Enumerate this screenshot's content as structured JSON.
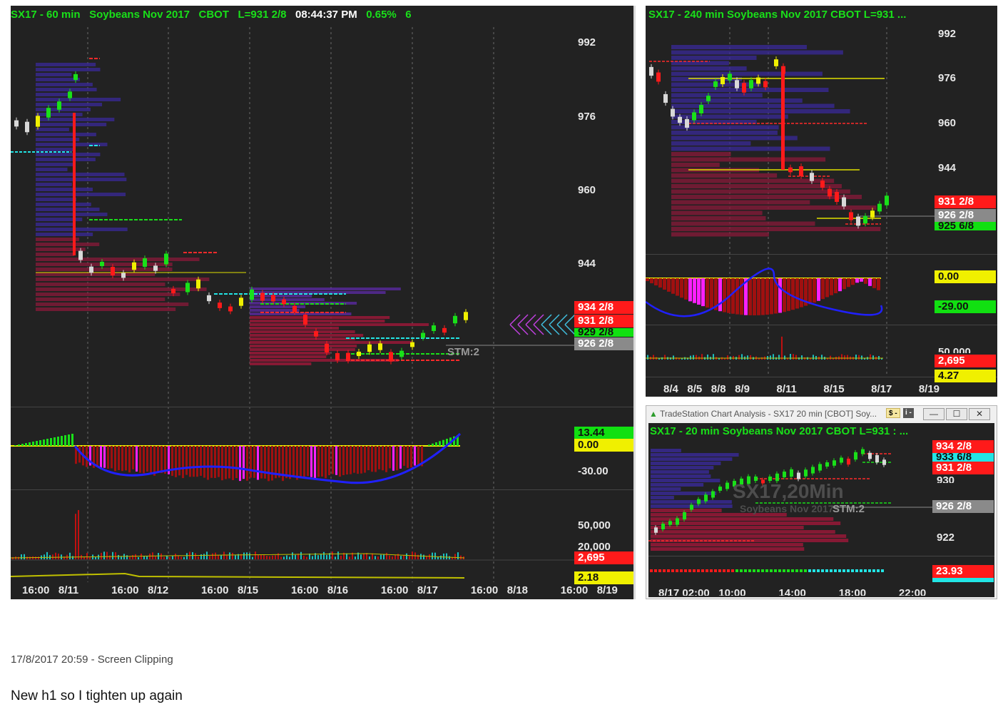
{
  "main_chart": {
    "title_symbol": "SX17 - 60 min",
    "title_name": "Soybeans Nov 2017",
    "title_exchange": "CBOT",
    "title_last": "L=931 2/8",
    "title_time": "08:44:37 PM",
    "title_change": "0.65%",
    "title_count": "6",
    "price_axis": [
      "992",
      "976",
      "960",
      "944"
    ],
    "price_boxes": [
      {
        "text": "934 2/8",
        "color": "red"
      },
      {
        "text": "931 2/8",
        "color": "red"
      },
      {
        "text": "929 2/8",
        "color": "green"
      },
      {
        "text": "926 2/8",
        "color": "gray"
      }
    ],
    "stm_label": "STM:2",
    "osc_boxes": [
      {
        "text": "13.44",
        "color": "green"
      },
      {
        "text": "0.00",
        "color": "yellow"
      }
    ],
    "osc_axis": "-30.00",
    "volume_axis": [
      "50,000",
      "20,000"
    ],
    "volume_boxes": [
      {
        "text": "2,695",
        "color": "red"
      },
      {
        "text": "2.18",
        "color": "yellow"
      }
    ],
    "time_axis": [
      "16:00",
      "8/11",
      "16:00",
      "8/12",
      "16:00",
      "8/15",
      "16:00",
      "8/16",
      "16:00",
      "8/17",
      "16:00",
      "8/18",
      "16:00",
      "8/19"
    ]
  },
  "chart_240": {
    "title": "SX17 - 240 min  Soybeans Nov 2017  CBOT  L=931  ...",
    "price_axis": [
      "992",
      "976",
      "960",
      "944"
    ],
    "price_boxes": [
      {
        "text": "931 2/8",
        "color": "red"
      },
      {
        "text": "926 2/8",
        "color": "gray"
      },
      {
        "text": "925 6/8",
        "color": "green"
      }
    ],
    "osc_boxes": [
      {
        "text": "0.00",
        "color": "yellow"
      },
      {
        "text": "-29.00",
        "color": "green"
      }
    ],
    "volume_boxes": [
      {
        "text": "50,000",
        "color": "none"
      },
      {
        "text": "2,695",
        "color": "red"
      },
      {
        "text": "4.27",
        "color": "yellow"
      }
    ],
    "time_axis": [
      "8/4",
      "8/5",
      "8/8",
      "8/9",
      "8/11",
      "8/15",
      "8/17",
      "8/19"
    ]
  },
  "window_20": {
    "window_title": "TradeStation Chart Analysis - SX17 20 min [CBOT] Soy...",
    "btn_dollar": "$ -",
    "btn_i": "i -",
    "btn_min": "—",
    "btn_max": "☐",
    "btn_close": "✕",
    "title": "SX17 - 20 min  Soybeans Nov 2017  CBOT  L=931 : ...",
    "watermark_big": "SX17,20Min",
    "watermark_small": "Soybeans Nov 2017",
    "stm_label": "STM:2",
    "price_axis": [
      "930",
      "922"
    ],
    "price_boxes": [
      {
        "text": "934 2/8",
        "color": "red"
      },
      {
        "text": "933 6/8",
        "color": "cyan"
      },
      {
        "text": "931 2/8",
        "color": "red"
      },
      {
        "text": "926 2/8",
        "color": "gray"
      }
    ],
    "osc_box": {
      "text": "23.93",
      "color": "red"
    },
    "time_axis": [
      "8/17 02:00",
      "10:00",
      "14:00",
      "18:00",
      "22:00"
    ]
  },
  "caption": "17/8/2017 20:59 - Screen Clipping",
  "note": "New h1 so I tighten up again"
}
